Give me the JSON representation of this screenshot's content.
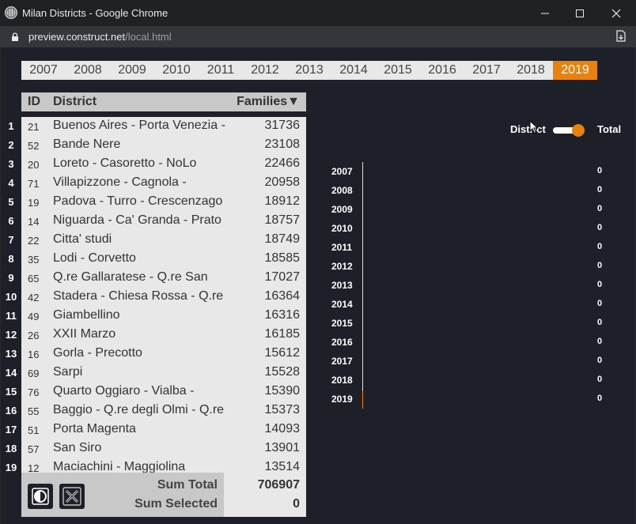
{
  "window": {
    "title": "Milan Districts - Google Chrome",
    "url_host": "preview.construct.net",
    "url_path": "/local.html"
  },
  "years": [
    "2007",
    "2008",
    "2009",
    "2010",
    "2011",
    "2012",
    "2013",
    "2014",
    "2015",
    "2016",
    "2017",
    "2018",
    "2019"
  ],
  "selected_year": "2019",
  "table": {
    "headers": {
      "id": "ID",
      "district": "District",
      "families": "Families",
      "sort_indicator": "▼"
    },
    "rows": [
      {
        "num": "1",
        "id": "21",
        "district": "Buenos Aires - Porta Venezia -",
        "families": "31736"
      },
      {
        "num": "2",
        "id": "52",
        "district": "Bande Nere",
        "families": "23108"
      },
      {
        "num": "3",
        "id": "20",
        "district": "Loreto - Casoretto - NoLo",
        "families": "22466"
      },
      {
        "num": "4",
        "id": "71",
        "district": "Villapizzone - Cagnola -",
        "families": "20958"
      },
      {
        "num": "5",
        "id": "19",
        "district": "Padova - Turro - Crescenzago",
        "families": "18912"
      },
      {
        "num": "6",
        "id": "14",
        "district": "Niguarda - Ca' Granda - Prato",
        "families": "18757"
      },
      {
        "num": "7",
        "id": "22",
        "district": "Citta' studi",
        "families": "18749"
      },
      {
        "num": "8",
        "id": "35",
        "district": "Lodi - Corvetto",
        "families": "18585"
      },
      {
        "num": "9",
        "id": "65",
        "district": "Q.re Gallaratese - Q.re San",
        "families": "17027"
      },
      {
        "num": "10",
        "id": "42",
        "district": "Stadera - Chiesa Rossa - Q.re",
        "families": "16364"
      },
      {
        "num": "11",
        "id": "49",
        "district": "Giambellino",
        "families": "16316"
      },
      {
        "num": "12",
        "id": "26",
        "district": "XXII Marzo",
        "families": "16185"
      },
      {
        "num": "13",
        "id": "16",
        "district": "Gorla - Precotto",
        "families": "15612"
      },
      {
        "num": "14",
        "id": "69",
        "district": "Sarpi",
        "families": "15528"
      },
      {
        "num": "15",
        "id": "76",
        "district": "Quarto Oggiaro - Vialba -",
        "families": "15390"
      },
      {
        "num": "16",
        "id": "55",
        "district": "Baggio - Q.re degli Olmi - Q.re",
        "families": "15373"
      },
      {
        "num": "17",
        "id": "51",
        "district": "Porta Magenta",
        "families": "14093"
      },
      {
        "num": "18",
        "id": "57",
        "district": "San Siro",
        "families": "13901"
      },
      {
        "num": "19",
        "id": "12",
        "district": "Maciachini - Maggiolina",
        "families": "13514"
      }
    ]
  },
  "footer": {
    "sum_total_label": "Sum Total",
    "sum_total_value": "706907",
    "sum_selected_label": "Sum Selected",
    "sum_selected_value": "0"
  },
  "toggle": {
    "left_label": "District",
    "right_label": "Total",
    "state": "Total"
  },
  "chart_data": {
    "type": "bar",
    "orientation": "horizontal",
    "categories": [
      "2007",
      "2008",
      "2009",
      "2010",
      "2011",
      "2012",
      "2013",
      "2014",
      "2015",
      "2016",
      "2017",
      "2018",
      "2019"
    ],
    "values": [
      0,
      0,
      0,
      0,
      0,
      0,
      0,
      0,
      0,
      0,
      0,
      0,
      0
    ],
    "highlighted": "2019",
    "colors": {
      "accent": "#e8820c",
      "axis": "#dddddd"
    }
  },
  "icons": {
    "app": "globe-icon",
    "lock": "lock-icon",
    "extension": "download-icon",
    "contrast": "contrast-icon",
    "clear": "clear-selection-icon"
  }
}
